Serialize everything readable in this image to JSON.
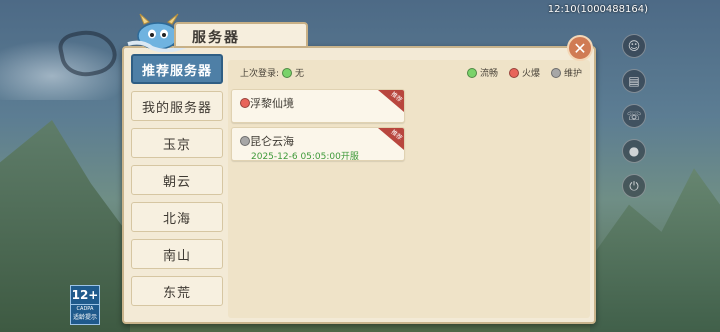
{
  "status_bar": {
    "time_id": "12:10(1000488164)"
  },
  "dialog": {
    "title": "服务器",
    "close_icon": "close-icon",
    "last_login_label": "上次登录:",
    "last_login_value": "无"
  },
  "legend": {
    "smooth": {
      "label": "流畅",
      "color": "#7ad36a"
    },
    "busy": {
      "label": "火爆",
      "color": "#e8645a"
    },
    "maintenance": {
      "label": "维护",
      "color": "#a7a7a7"
    }
  },
  "tabs": [
    {
      "label": "推荐服务器",
      "active": true
    },
    {
      "label": "我的服务器",
      "active": false
    },
    {
      "label": "玉京",
      "active": false
    },
    {
      "label": "朝云",
      "active": false
    },
    {
      "label": "北海",
      "active": false
    },
    {
      "label": "南山",
      "active": false
    },
    {
      "label": "东荒",
      "active": false
    }
  ],
  "servers": [
    {
      "name": "浮黎仙境",
      "status": "busy",
      "status_color": "#e8645a",
      "badge": "推荐"
    },
    {
      "name": "昆仑云海",
      "status": "maintenance",
      "status_color": "#a7a7a7",
      "badge": "推荐",
      "open_time": "2025-12-6 05:05:00开服"
    }
  ],
  "age_rating": {
    "number": "12+",
    "org": "CADPA",
    "caption": "适龄提示"
  },
  "colors": {
    "accent_tab": "#4e7fa6",
    "panel_bg": "#f3ead6"
  }
}
